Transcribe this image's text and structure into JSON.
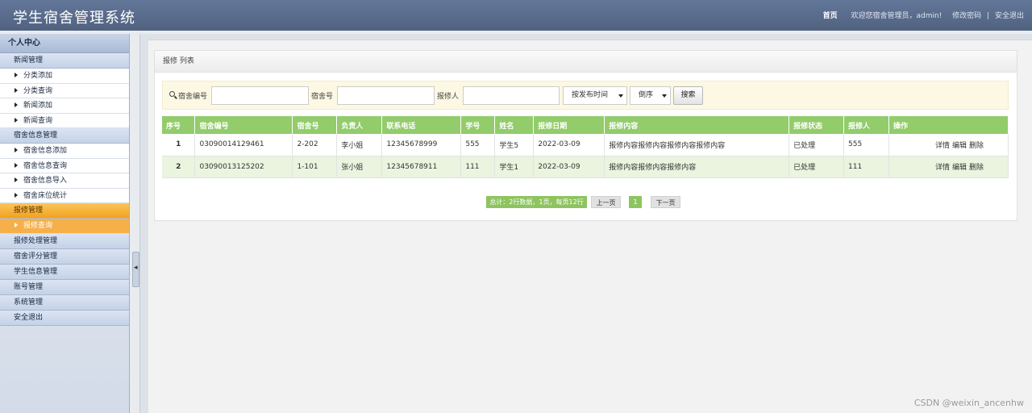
{
  "header": {
    "title": "学生宿舍管理系统",
    "home": "首页",
    "welcome": "欢迎您宿舍管理员，admin!",
    "change_password": "修改密码",
    "separator": "|",
    "logout": "安全退出"
  },
  "sidebar": {
    "heading": "个人中心",
    "news_group": "新闻管理",
    "news_items": [
      "分类添加",
      "分类查询",
      "新闻添加",
      "新闻查询"
    ],
    "dorm_group": "宿舍信息管理",
    "dorm_items": [
      "宿舍信息添加",
      "宿舍信息查询",
      "宿舍信息导入",
      "宿舍床位统计"
    ],
    "repair_group": "报修管理",
    "repair_items": [
      "报修查询"
    ],
    "other_groups": [
      "报修处理管理",
      "宿舍评分管理",
      "学生信息管理",
      "账号管理",
      "系统管理",
      "安全退出"
    ]
  },
  "panel": {
    "title": "报修 列表"
  },
  "search": {
    "dorm_code_label": "宿舍编号",
    "dorm_no_label": "宿舍号",
    "reporter_label": "报修人",
    "dorm_code_value": "",
    "dorm_no_value": "",
    "reporter_value": "",
    "sort_field": "按发布时间",
    "sort_order": "倒序",
    "search_button": "搜索"
  },
  "table": {
    "headers": [
      "序号",
      "宿舍编号",
      "宿舍号",
      "负责人",
      "联系电话",
      "学号",
      "姓名",
      "报修日期",
      "报修内容",
      "报修状态",
      "报修人",
      "操作"
    ],
    "rows": [
      [
        "1",
        "03090014129461",
        "2-202",
        "李小姐",
        "12345678999",
        "555",
        "学生5",
        "2022-03-09",
        "报修内容报修内容报修内容报修内容",
        "已处理",
        "555"
      ],
      [
        "2",
        "03090013125202",
        "1-101",
        "张小姐",
        "12345678911",
        "111",
        "学生1",
        "2022-03-09",
        "报修内容报修内容报修内容",
        "已处理",
        "111"
      ]
    ],
    "actions": [
      "详情",
      "编辑",
      "删除"
    ]
  },
  "pager": {
    "info": "总计：2行数据，1页，每页12行",
    "prev": "上一页",
    "current": "1",
    "next": "下一页"
  },
  "watermark": "CSDN @weixin_ancenhw",
  "colors": {
    "header": "#596d8e",
    "table_header": "#92cc6b",
    "active_menu": "#f6b04a",
    "search_bg": "#fdf8e4"
  }
}
